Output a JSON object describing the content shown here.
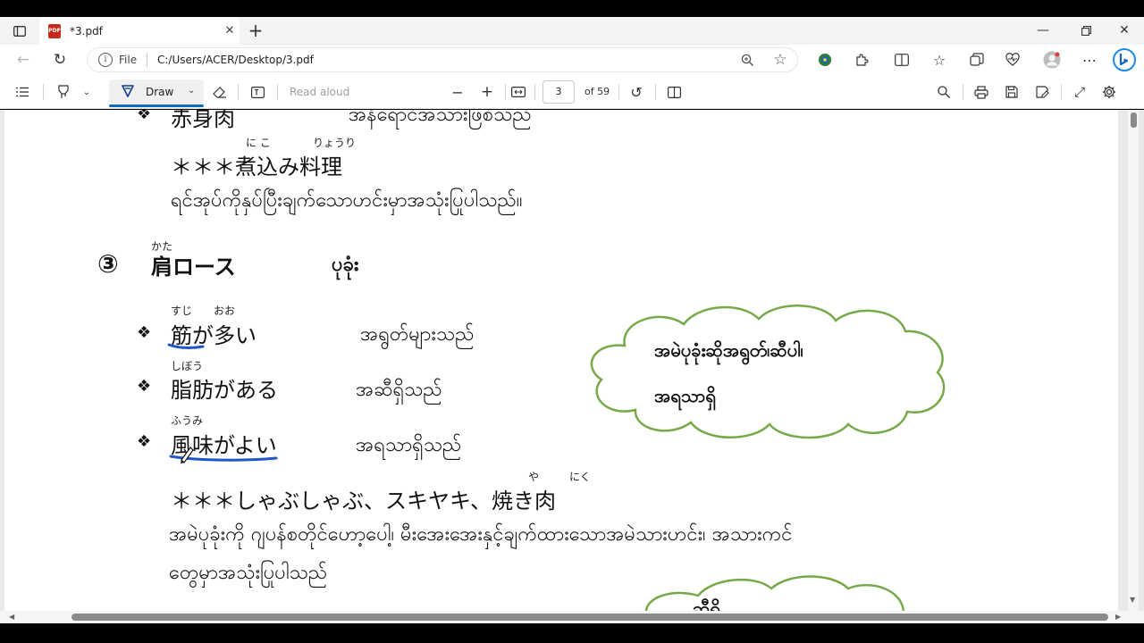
{
  "browser": {
    "tab_title": "*3.pdf",
    "pdf_icon_text": "PDF",
    "new_tab": "+",
    "file_label": "File",
    "url": "C:/Users/ACER/Desktop/3.pdf"
  },
  "pdf_toolbar": {
    "draw_label": "Draw",
    "read_aloud": "Read aloud",
    "page_current": "3",
    "page_total": "of 59"
  },
  "document": {
    "top_partial_left": "❖  赤身肉",
    "top_partial_right": "အနီရောင်အသားဖြစ်သည်",
    "ruby_nikomi_1": "に こ",
    "ruby_nikomi_2": "りょうり",
    "nikomi_dish": "＊＊＊煮込み料理",
    "nikomi_desc": "ရင်အုပ်ကိုနှပ်ပြီးချက်သောဟင်းမှာအသုံးပြုပါသည်။",
    "section_number": "③",
    "ruby_kata": "かた",
    "section_title": "肩ロース",
    "section_title_mm": "ပုခုံး",
    "items": [
      {
        "ruby": "すじ　　おお",
        "jp": "筋が多い",
        "mm": "အရွတ်များသည်"
      },
      {
        "ruby": "しぼう",
        "jp": "脂肪がある",
        "mm": "အဆီရှိသည်"
      },
      {
        "ruby": "ふうみ",
        "jp": "風味がよい",
        "mm": "အရသာရှိသည်"
      }
    ],
    "bullet": "❖",
    "ruby_ya": "や",
    "ruby_niku": "にく",
    "dishes": "＊＊＊しゃぶしゃぶ、スキヤキ、焼き肉",
    "dishes_desc_1": "အမဲပုခုံးကို ဂျပန်စတိုင်ဟော့ပေါ့၊ မီးအေးအေးနှင့်ချက်ထားသောအမဲသားဟင်း၊ အသားကင်",
    "dishes_desc_2": "တွေမှာအသုံးပြုပါသည်",
    "cloud_line_1": "အမဲပုခုံးဆိုအရွတ်၊ဆီပါ၊",
    "cloud_line_2": "အရသာရှိ",
    "cloud2_partial": "ဆီရှိ"
  },
  "colors": {
    "cloud_stroke": "#77a94a",
    "ink_underline": "#1f57c6"
  }
}
